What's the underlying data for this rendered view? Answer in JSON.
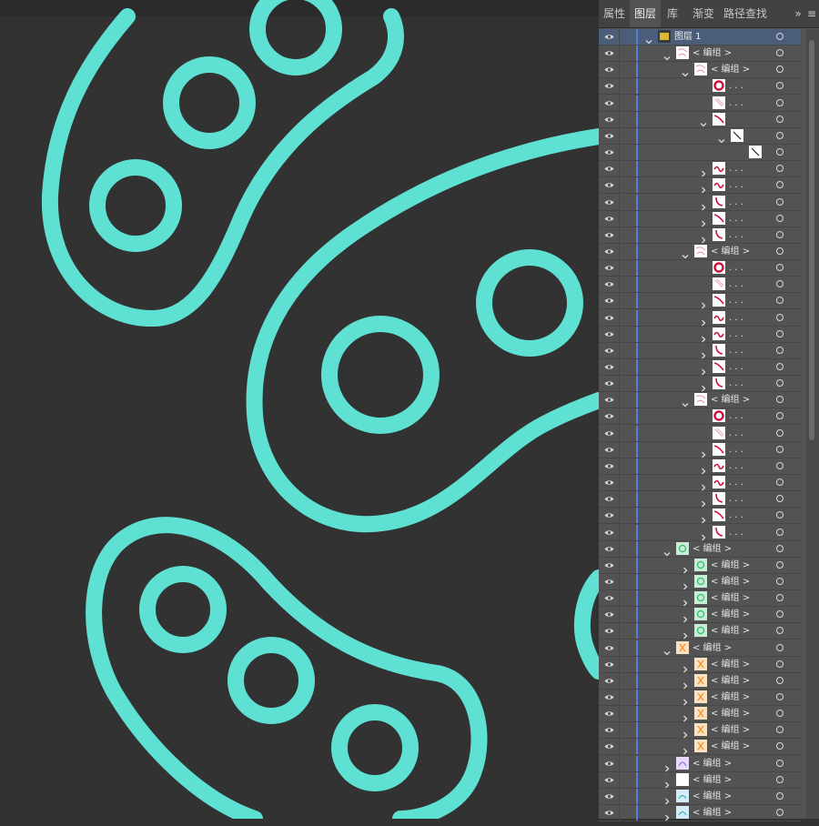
{
  "panel": {
    "tabs": [
      {
        "label": "属性",
        "active": false
      },
      {
        "label": "图层",
        "active": true
      },
      {
        "label": "库",
        "active": false
      },
      {
        "label": "渐变",
        "active": false
      },
      {
        "label": "路径查找器",
        "active": false
      }
    ],
    "overflow_icon": "double-chevron-right-icon",
    "menu_icon": "hamburger-menu-icon",
    "layer_name": "图层 1",
    "group_label": "< 编组 >",
    "path_label": ". . ."
  },
  "colors": {
    "canvas_bg": "#323232",
    "stroke": "#5ee1d3",
    "panel_bg": "#535353",
    "layer_accent": "#4f7fe0",
    "red_art": "#d0103a",
    "green_art": "#2fbd6b",
    "orange_art": "#f0901e",
    "purple_art": "#9b6be0",
    "teal_art": "#3ab0c8"
  },
  "rows": [
    {
      "kind": "layer",
      "indent": 0,
      "expanded": true,
      "label": "图层 1",
      "thumb": "layer",
      "selected": true
    },
    {
      "kind": "group",
      "indent": 1,
      "expanded": true,
      "label": "< 编组 >",
      "thumb": "red-mix"
    },
    {
      "kind": "group",
      "indent": 2,
      "expanded": true,
      "label": "< 编组 >",
      "thumb": "red-mix"
    },
    {
      "kind": "path",
      "indent": 3,
      "label": ". . .",
      "thumb": "red-ring"
    },
    {
      "kind": "path",
      "indent": 3,
      "label": ". . .",
      "thumb": "slash-light"
    },
    {
      "kind": "group",
      "indent": 3,
      "expanded": true,
      "label": "",
      "thumb": "red-curve"
    },
    {
      "kind": "group",
      "indent": 4,
      "expanded": true,
      "label": "",
      "thumb": "black-line"
    },
    {
      "kind": "path",
      "indent": 5,
      "label": "",
      "thumb": "black-line"
    },
    {
      "kind": "group",
      "indent": 3,
      "expanded": false,
      "label": ". . .",
      "thumb": "red-wave"
    },
    {
      "kind": "group",
      "indent": 3,
      "expanded": false,
      "label": ". . .",
      "thumb": "red-wave"
    },
    {
      "kind": "group",
      "indent": 3,
      "expanded": false,
      "label": ". . .",
      "thumb": "red-hook"
    },
    {
      "kind": "group",
      "indent": 3,
      "expanded": false,
      "label": ". . .",
      "thumb": "red-curve"
    },
    {
      "kind": "group",
      "indent": 3,
      "expanded": false,
      "label": ". . .",
      "thumb": "red-hook"
    },
    {
      "kind": "group",
      "indent": 2,
      "expanded": true,
      "label": "< 编组 >",
      "thumb": "red-mix"
    },
    {
      "kind": "path",
      "indent": 3,
      "label": ". . .",
      "thumb": "red-ring"
    },
    {
      "kind": "path",
      "indent": 3,
      "label": ". . .",
      "thumb": "slash-light"
    },
    {
      "kind": "group",
      "indent": 3,
      "expanded": false,
      "label": ". . .",
      "thumb": "red-curve"
    },
    {
      "kind": "group",
      "indent": 3,
      "expanded": false,
      "label": ". . .",
      "thumb": "red-wave"
    },
    {
      "kind": "group",
      "indent": 3,
      "expanded": false,
      "label": ". . .",
      "thumb": "red-wave"
    },
    {
      "kind": "group",
      "indent": 3,
      "expanded": false,
      "label": ". . .",
      "thumb": "red-hook"
    },
    {
      "kind": "group",
      "indent": 3,
      "expanded": false,
      "label": ". . .",
      "thumb": "red-curve"
    },
    {
      "kind": "group",
      "indent": 3,
      "expanded": false,
      "label": ". . .",
      "thumb": "red-hook"
    },
    {
      "kind": "group",
      "indent": 2,
      "expanded": true,
      "label": "< 编组 >",
      "thumb": "red-mix"
    },
    {
      "kind": "path",
      "indent": 3,
      "label": ". . .",
      "thumb": "red-ring"
    },
    {
      "kind": "path",
      "indent": 3,
      "label": ". . .",
      "thumb": "slash-light"
    },
    {
      "kind": "group",
      "indent": 3,
      "expanded": false,
      "label": ". . .",
      "thumb": "red-curve"
    },
    {
      "kind": "group",
      "indent": 3,
      "expanded": false,
      "label": ". . .",
      "thumb": "red-wave"
    },
    {
      "kind": "group",
      "indent": 3,
      "expanded": false,
      "label": ". . .",
      "thumb": "red-wave"
    },
    {
      "kind": "group",
      "indent": 3,
      "expanded": false,
      "label": ". . .",
      "thumb": "red-hook"
    },
    {
      "kind": "group",
      "indent": 3,
      "expanded": false,
      "label": ". . .",
      "thumb": "red-curve"
    },
    {
      "kind": "group",
      "indent": 3,
      "expanded": false,
      "label": ". . .",
      "thumb": "red-hook"
    },
    {
      "kind": "group",
      "indent": 1,
      "expanded": true,
      "label": "< 编组 >",
      "thumb": "green"
    },
    {
      "kind": "group",
      "indent": 2,
      "expanded": false,
      "label": "< 编组 >",
      "thumb": "green"
    },
    {
      "kind": "group",
      "indent": 2,
      "expanded": false,
      "label": "< 编组 >",
      "thumb": "green"
    },
    {
      "kind": "group",
      "indent": 2,
      "expanded": false,
      "label": "< 编组 >",
      "thumb": "green"
    },
    {
      "kind": "group",
      "indent": 2,
      "expanded": false,
      "label": "< 编组 >",
      "thumb": "green"
    },
    {
      "kind": "group",
      "indent": 2,
      "expanded": false,
      "label": "< 编组 >",
      "thumb": "green"
    },
    {
      "kind": "group",
      "indent": 1,
      "expanded": true,
      "label": "< 编组 >",
      "thumb": "orange"
    },
    {
      "kind": "group",
      "indent": 2,
      "expanded": false,
      "label": "< 编组 >",
      "thumb": "orange"
    },
    {
      "kind": "group",
      "indent": 2,
      "expanded": false,
      "label": "< 编组 >",
      "thumb": "orange"
    },
    {
      "kind": "group",
      "indent": 2,
      "expanded": false,
      "label": "< 编组 >",
      "thumb": "orange"
    },
    {
      "kind": "group",
      "indent": 2,
      "expanded": false,
      "label": "< 编组 >",
      "thumb": "orange"
    },
    {
      "kind": "group",
      "indent": 2,
      "expanded": false,
      "label": "< 编组 >",
      "thumb": "orange"
    },
    {
      "kind": "group",
      "indent": 2,
      "expanded": false,
      "label": "< 编组 >",
      "thumb": "orange"
    },
    {
      "kind": "group",
      "indent": 1,
      "expanded": false,
      "label": "< 编组 >",
      "thumb": "purple"
    },
    {
      "kind": "group",
      "indent": 1,
      "expanded": false,
      "label": "< 编组 >",
      "thumb": "blank"
    },
    {
      "kind": "group",
      "indent": 1,
      "expanded": false,
      "label": "< 编组 >",
      "thumb": "teal"
    },
    {
      "kind": "group",
      "indent": 1,
      "expanded": false,
      "label": "< 编组 >",
      "thumb": "teal"
    }
  ]
}
